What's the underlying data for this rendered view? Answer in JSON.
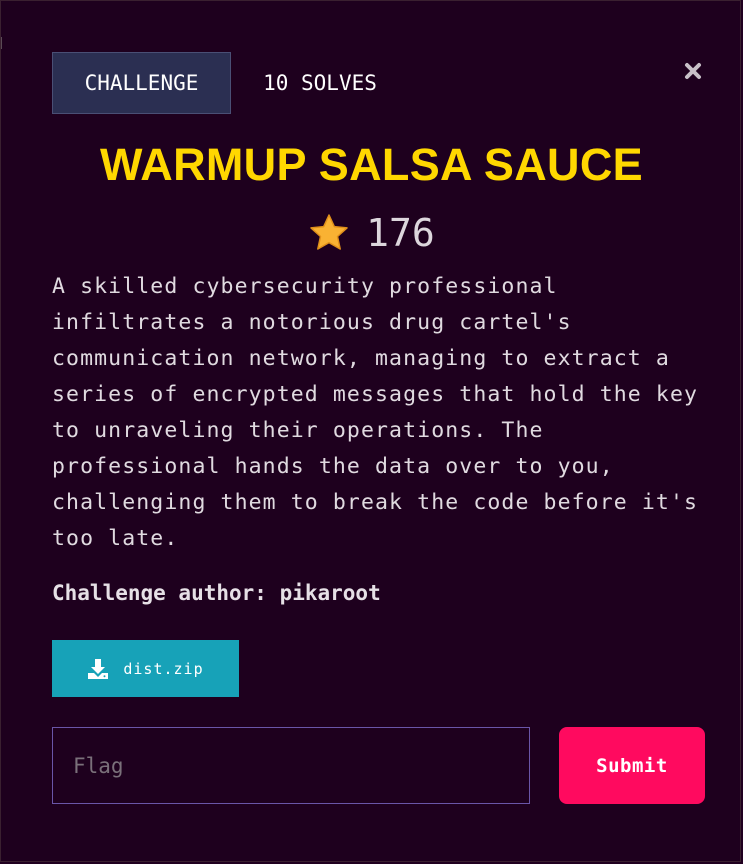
{
  "tabs": {
    "challenge_label": "CHALLENGE",
    "solves_label": "10 SOLVES"
  },
  "close_icon": "close-icon",
  "challenge": {
    "title": "WARMUP SALSA SAUCE",
    "points_icon": "star-icon",
    "points": "176",
    "description": "A skilled cybersecurity professional infiltrates a notorious drug cartel's communication network, managing to extract a series of encrypted messages that hold the key to unraveling their operations. The professional hands the data over to you, challenging them to break the code before it's too late.",
    "author": "Challenge author: pikaroot"
  },
  "download": {
    "icon": "download-icon",
    "label": "dist.zip"
  },
  "flag_form": {
    "placeholder": "Flag",
    "value": "",
    "submit_label": "Submit"
  },
  "colors": {
    "background": "#1e001e",
    "title": "#ffd700",
    "tab_active": "#2b2f52",
    "download_button": "#17a2b8",
    "submit_button": "#ff0a5f",
    "input_border": "#6a55a8"
  }
}
